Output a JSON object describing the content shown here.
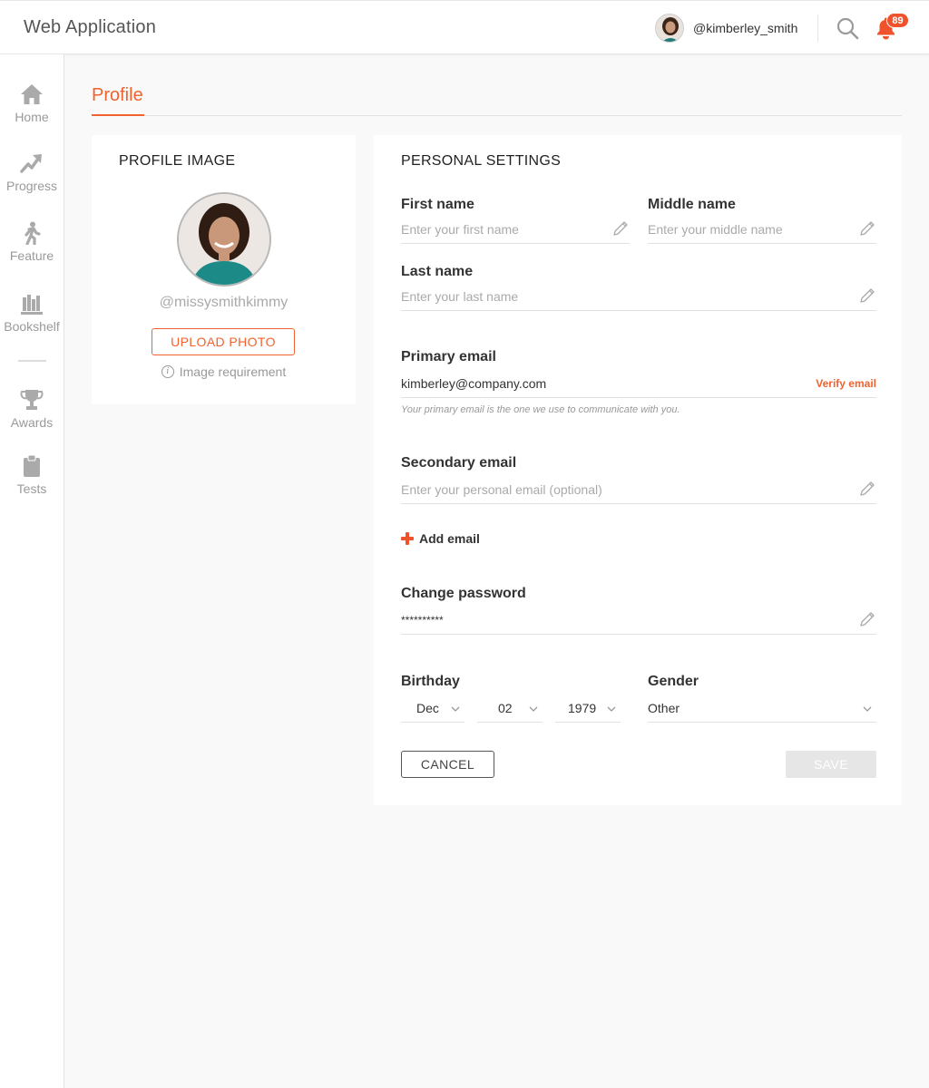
{
  "app": {
    "title": "Web Application"
  },
  "header": {
    "username": "@kimberley_smith",
    "notification_count": "89",
    "icons": [
      "user-avatar",
      "search-icon",
      "bell-icon"
    ]
  },
  "sidebar": {
    "items": [
      {
        "label": "Home",
        "icon": "home-icon"
      },
      {
        "label": "Progress",
        "icon": "trending-up-icon"
      },
      {
        "label": "Feature",
        "icon": "walking-person-icon"
      },
      {
        "label": "Bookshelf",
        "icon": "bookshelf-icon"
      },
      {
        "label": "Awards",
        "icon": "trophy-icon"
      },
      {
        "label": "Tests",
        "icon": "clipboard-icon"
      }
    ]
  },
  "page": {
    "tab": "Profile"
  },
  "profile_card": {
    "title": "PROFILE IMAGE",
    "handle": "@missysmithkimmy",
    "upload_label": "UPLOAD PHOTO",
    "requirement_label": "Image requirement"
  },
  "settings": {
    "title": "PERSONAL SETTINGS",
    "first_name": {
      "label": "First name",
      "placeholder": "Enter your first name",
      "value": ""
    },
    "middle_name": {
      "label": "Middle name",
      "placeholder": "Enter your middle name",
      "value": ""
    },
    "last_name": {
      "label": "Last name",
      "placeholder": "Enter your last name",
      "value": ""
    },
    "primary_email": {
      "label": "Primary email",
      "value": "kimberley@company.com",
      "verify_label": "Verify email",
      "hint": "Your primary email is the one we use to communicate with you."
    },
    "secondary_email": {
      "label": "Secondary email",
      "placeholder": "Enter your personal email (optional)",
      "value": ""
    },
    "add_email_label": "Add email",
    "password": {
      "label": "Change password",
      "value": "**********"
    },
    "birthday": {
      "label": "Birthday",
      "month": "Dec",
      "day": "02",
      "year": "1979"
    },
    "gender": {
      "label": "Gender",
      "value": "Other"
    },
    "cancel_label": "CANCEL",
    "save_label": "SAVE"
  },
  "colors": {
    "accent": "#f0622f",
    "badge": "#f0522b",
    "background": "#f9f9f9",
    "card": "#ffffff"
  }
}
